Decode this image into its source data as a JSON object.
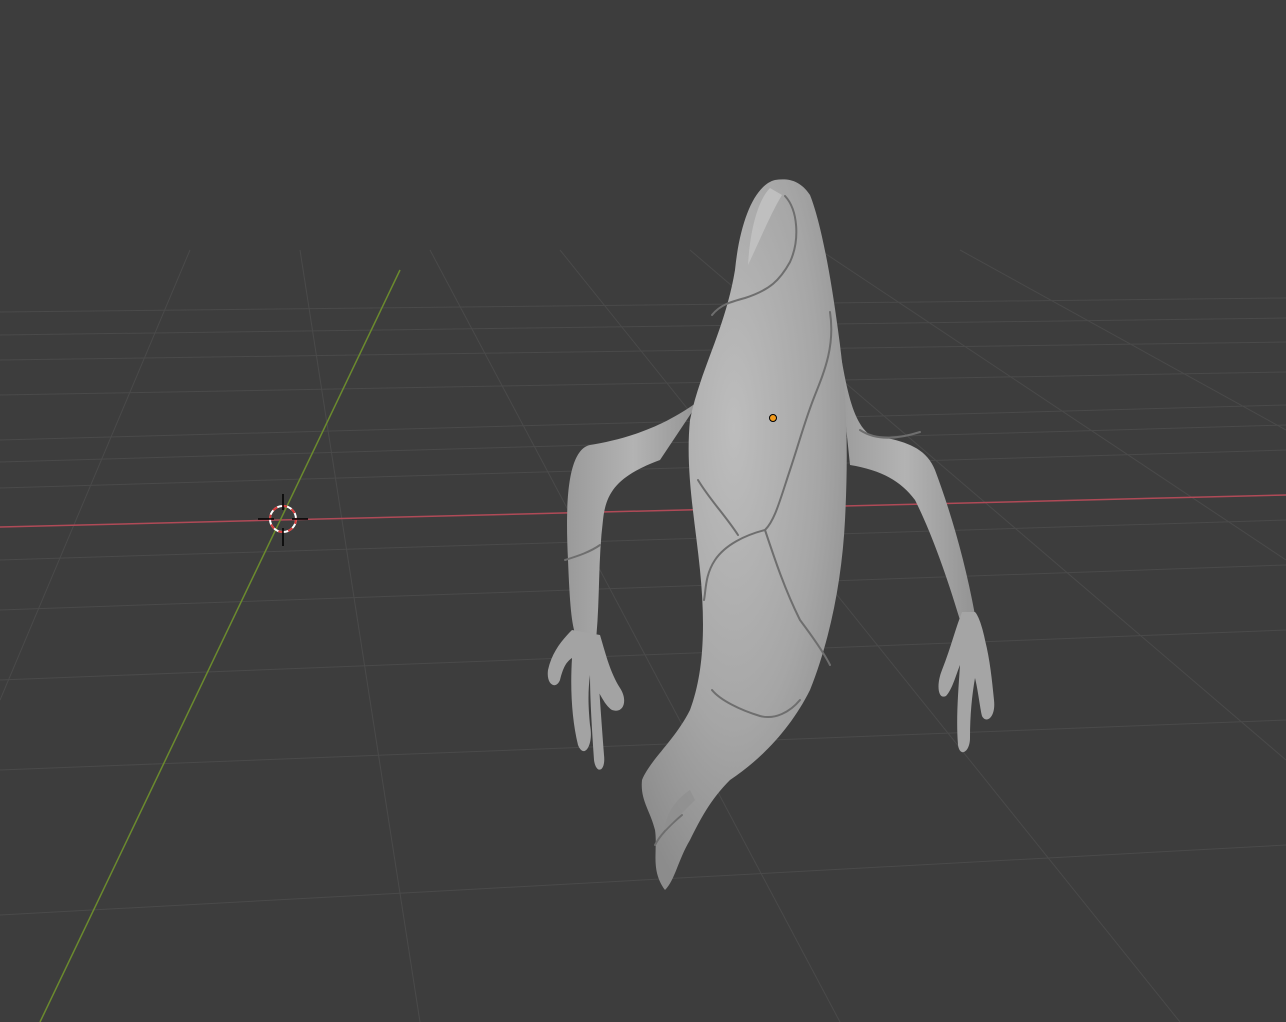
{
  "viewport": {
    "background_color": "#3d3d3d",
    "grid_line_color": "#4a4a4a",
    "x_axis_color": "#b04a57",
    "y_axis_color": "#6b8a2e",
    "object_color": "#a9a9a9",
    "origin_color": "#f29a1b",
    "cursor_colors": [
      "#ffffff",
      "#d83a3a"
    ]
  },
  "scene": {
    "object_icon": "ghost-mesh",
    "cursor_icon": "3d-cursor-icon",
    "origin_icon": "object-origin-icon"
  }
}
